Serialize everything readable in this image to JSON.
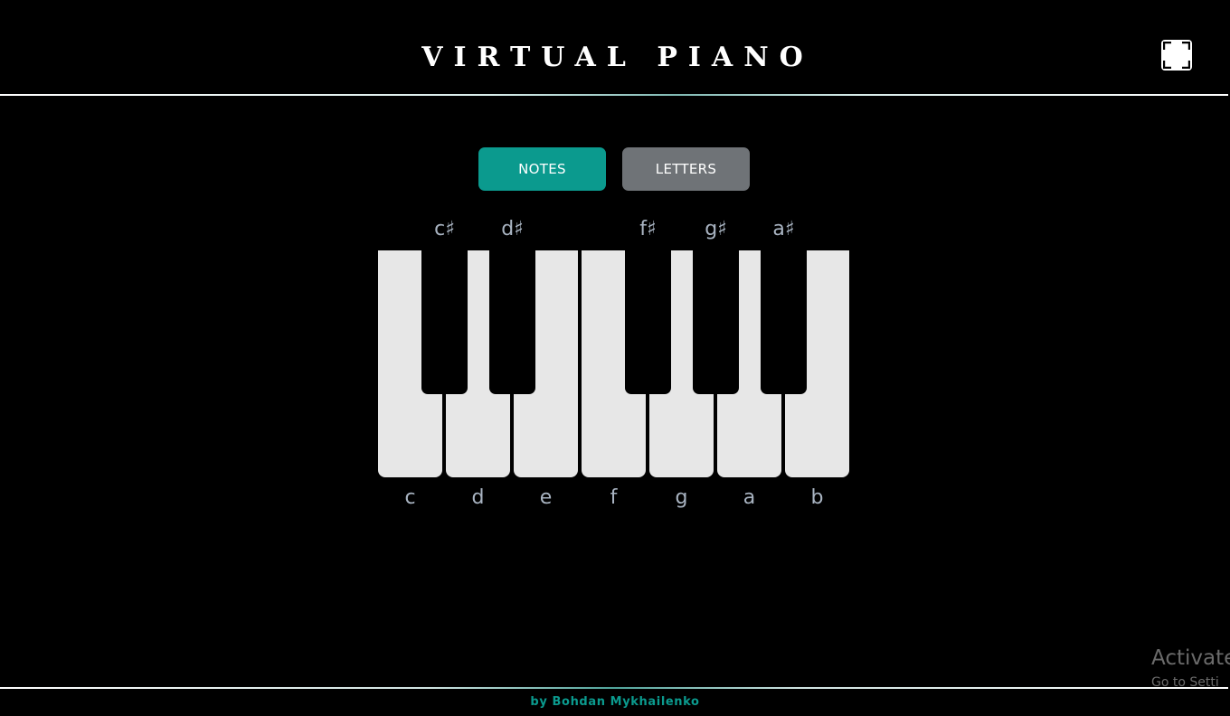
{
  "app": {
    "title": "VIRTUAL PIANO",
    "fullscreen_icon": "fullscreen-icon"
  },
  "mode_toggle": {
    "notes_label": "NOTES",
    "letters_label": "LETTERS",
    "selected": "NOTES"
  },
  "piano": {
    "white_keys": [
      {
        "note": "c",
        "label": "c"
      },
      {
        "note": "d",
        "label": "d"
      },
      {
        "note": "e",
        "label": "e"
      },
      {
        "note": "f",
        "label": "f"
      },
      {
        "note": "g",
        "label": "g"
      },
      {
        "note": "a",
        "label": "a"
      },
      {
        "note": "b",
        "label": "b"
      }
    ],
    "black_keys": [
      {
        "note": "c#",
        "label": "c♯"
      },
      {
        "note": "d#",
        "label": "d♯"
      },
      {
        "note": "f#",
        "label": "f♯"
      },
      {
        "note": "g#",
        "label": "g♯"
      },
      {
        "note": "a#",
        "label": "a♯"
      }
    ]
  },
  "footer": {
    "credit": "by Bohdan Mykhailenko"
  },
  "watermark": {
    "title": "Activate",
    "subtitle": "Go to Setti"
  },
  "colors": {
    "background": "#000000",
    "accent": "#0b9a8e",
    "button_inactive": "#6f7377",
    "white_key": "#e7e7e7",
    "black_key": "#000000",
    "key_label": "#a9b4c2"
  }
}
